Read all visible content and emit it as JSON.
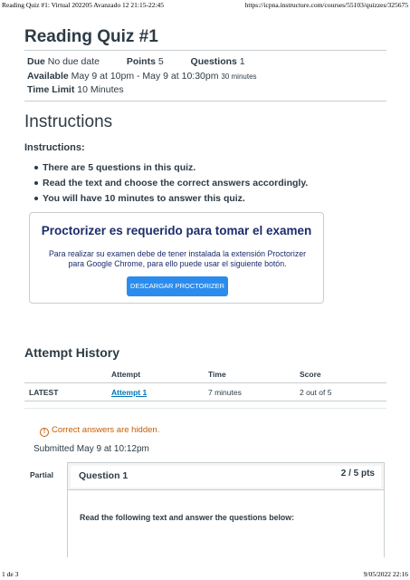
{
  "print_header": {
    "left": "Reading Quiz #1: Virtual 202205 Avanzado 12 21:15-22:45",
    "right": "https://icpna.instructure.com/courses/55103/quizzes/325675"
  },
  "print_footer": {
    "left": "1 de 3",
    "right": "9/05/2022 22:16"
  },
  "quiz": {
    "title": "Reading Quiz #1",
    "due_label": "Due",
    "due_value": "No due date",
    "points_label": "Points",
    "points_value": "5",
    "questions_label": "Questions",
    "questions_value": "1",
    "available_label": "Available",
    "available_value": "May 9 at 10pm - May 9 at 10:30pm",
    "available_duration": "30 minutes",
    "time_limit_label": "Time Limit",
    "time_limit_value": "10 Minutes"
  },
  "instructions": {
    "heading": "Instructions",
    "label": "Instructions:",
    "items": [
      "There are 5 questions in this quiz.",
      "Read the text and choose the correct answers accordingly.",
      "You will have 10 minutes to answer this quiz."
    ]
  },
  "proctorizer": {
    "title": "Proctorizer es requerido para tomar el examen",
    "text": "Para realizar su examen debe de tener instalada la extensión Proctorizer para Google Chrome, para ello puede usar el siguiente botón.",
    "button_label": "DESCARGAR PROCTORIZER"
  },
  "attempt_history": {
    "heading": "Attempt History",
    "columns": [
      "",
      "Attempt",
      "Time",
      "Score"
    ],
    "rows": [
      {
        "label": "LATEST",
        "attempt": "Attempt 1",
        "time": "7 minutes",
        "score": "2 out of 5"
      }
    ]
  },
  "results": {
    "hidden_note": "Correct answers are hidden.",
    "submitted": "Submitted May 9 at 10:12pm"
  },
  "question": {
    "status": "Partial",
    "title": "Question 1",
    "points": "2 / 5 pts",
    "body": "Read the following text and answer the questions below:"
  },
  "colors": {
    "text": "#2d3b45",
    "link": "#0374b5",
    "proctor_title": "#1b2c6b",
    "button": "#2b8ced",
    "warning": "#c85d00"
  }
}
